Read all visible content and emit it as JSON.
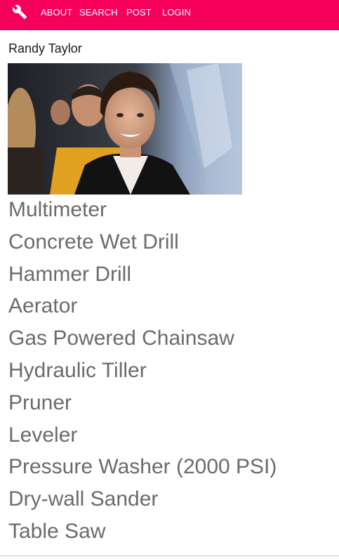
{
  "colors": {
    "nav_background": "#f5005a",
    "nav_text": "#ffffff",
    "list_text": "#6b6b6b"
  },
  "nav": {
    "logo_icon": "wrench-icon",
    "links": [
      "ABOUT",
      "SEARCH",
      "POST",
      "LOGIN"
    ]
  },
  "profile": {
    "name": "Randy Taylor",
    "photo_icon": "profile-photo"
  },
  "tools": [
    "Multimeter",
    "Concrete Wet Drill",
    "Hammer Drill",
    "Aerator",
    "Gas Powered Chainsaw",
    "Hydraulic Tiller",
    "Pruner",
    "Leveler",
    "Pressure Washer (2000 PSI)",
    "Dry-wall Sander",
    "Table Saw"
  ]
}
